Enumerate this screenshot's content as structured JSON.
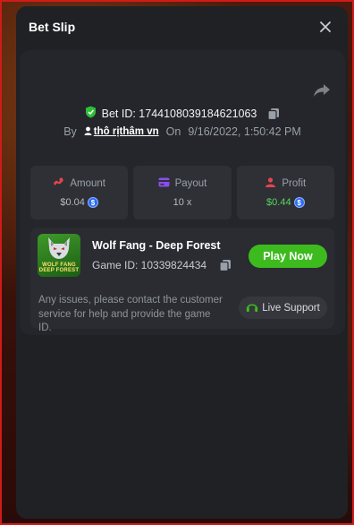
{
  "modal": {
    "title": "Bet Slip"
  },
  "bet": {
    "id_label": "Bet ID: 1744108039184621063",
    "by_label": "By",
    "username": "thô rịthâm vn",
    "on_label": "On",
    "datetime": "9/16/2022, 1:50:42 PM"
  },
  "stats": [
    {
      "label": "Amount",
      "value": "$0.04",
      "icon": "amount-icon",
      "color": "#e2464b"
    },
    {
      "label": "Payout",
      "value": "10 x",
      "icon": "payout-icon",
      "color": "#8a4df0"
    },
    {
      "label": "Profit",
      "value": "$0.44",
      "icon": "profit-icon",
      "color": "#e2464b",
      "value_color": "#56d65c"
    }
  ],
  "game": {
    "thumb_text": "WOLF FANG DEEP FOREST",
    "name": "Wolf Fang - Deep Forest",
    "id_label": "Game ID: 10339824434",
    "play_label": "Play Now",
    "support_text": "Any issues, please contact the customer service for help and provide the game ID.",
    "support_label": "Live Support"
  },
  "colors": {
    "accent_green": "#3dbb1e",
    "verified": "#2fbf3a",
    "coin": "#2a6cf6"
  }
}
